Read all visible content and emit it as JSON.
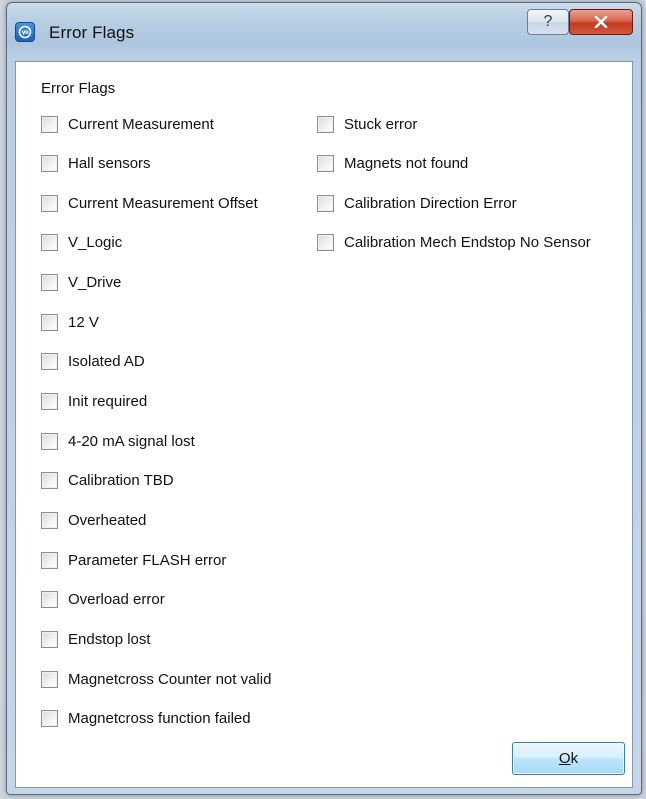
{
  "window": {
    "title": "Error Flags",
    "help_glyph": "?",
    "icons": {
      "app": "app-logo-icon",
      "help": "help-icon",
      "close": "close-icon"
    }
  },
  "group": {
    "title": "Error Flags"
  },
  "left_flags": [
    {
      "label": "Current Measurement",
      "checked": false
    },
    {
      "label": "Hall sensors",
      "checked": false
    },
    {
      "label": "Current Measurement Offset",
      "checked": false
    },
    {
      "label": "V_Logic",
      "checked": false
    },
    {
      "label": "V_Drive",
      "checked": false
    },
    {
      "label": "12 V",
      "checked": false
    },
    {
      "label": "Isolated AD",
      "checked": false
    },
    {
      "label": "Init required",
      "checked": false
    },
    {
      "label": "4-20 mA signal lost",
      "checked": false
    },
    {
      "label": "Calibration TBD",
      "checked": false
    },
    {
      "label": "Overheated",
      "checked": false
    },
    {
      "label": "Parameter FLASH error",
      "checked": false
    },
    {
      "label": "Overload error",
      "checked": false
    },
    {
      "label": "Endstop lost",
      "checked": false
    },
    {
      "label": "Magnetcross Counter not valid",
      "checked": false
    },
    {
      "label": "Magnetcross function failed",
      "checked": false
    }
  ],
  "right_flags": [
    {
      "label": "Stuck error",
      "checked": false
    },
    {
      "label": "Magnets not found",
      "checked": false
    },
    {
      "label": "Calibration Direction Error",
      "checked": false
    },
    {
      "label": "Calibration Mech Endstop No Sensor",
      "checked": false
    }
  ],
  "ok_button": {
    "mnemonic": "O",
    "rest": "k"
  },
  "colors": {
    "close_button": "#c13c20",
    "titlebar": "#b7cde3",
    "ok_button": "#bee6fd"
  }
}
